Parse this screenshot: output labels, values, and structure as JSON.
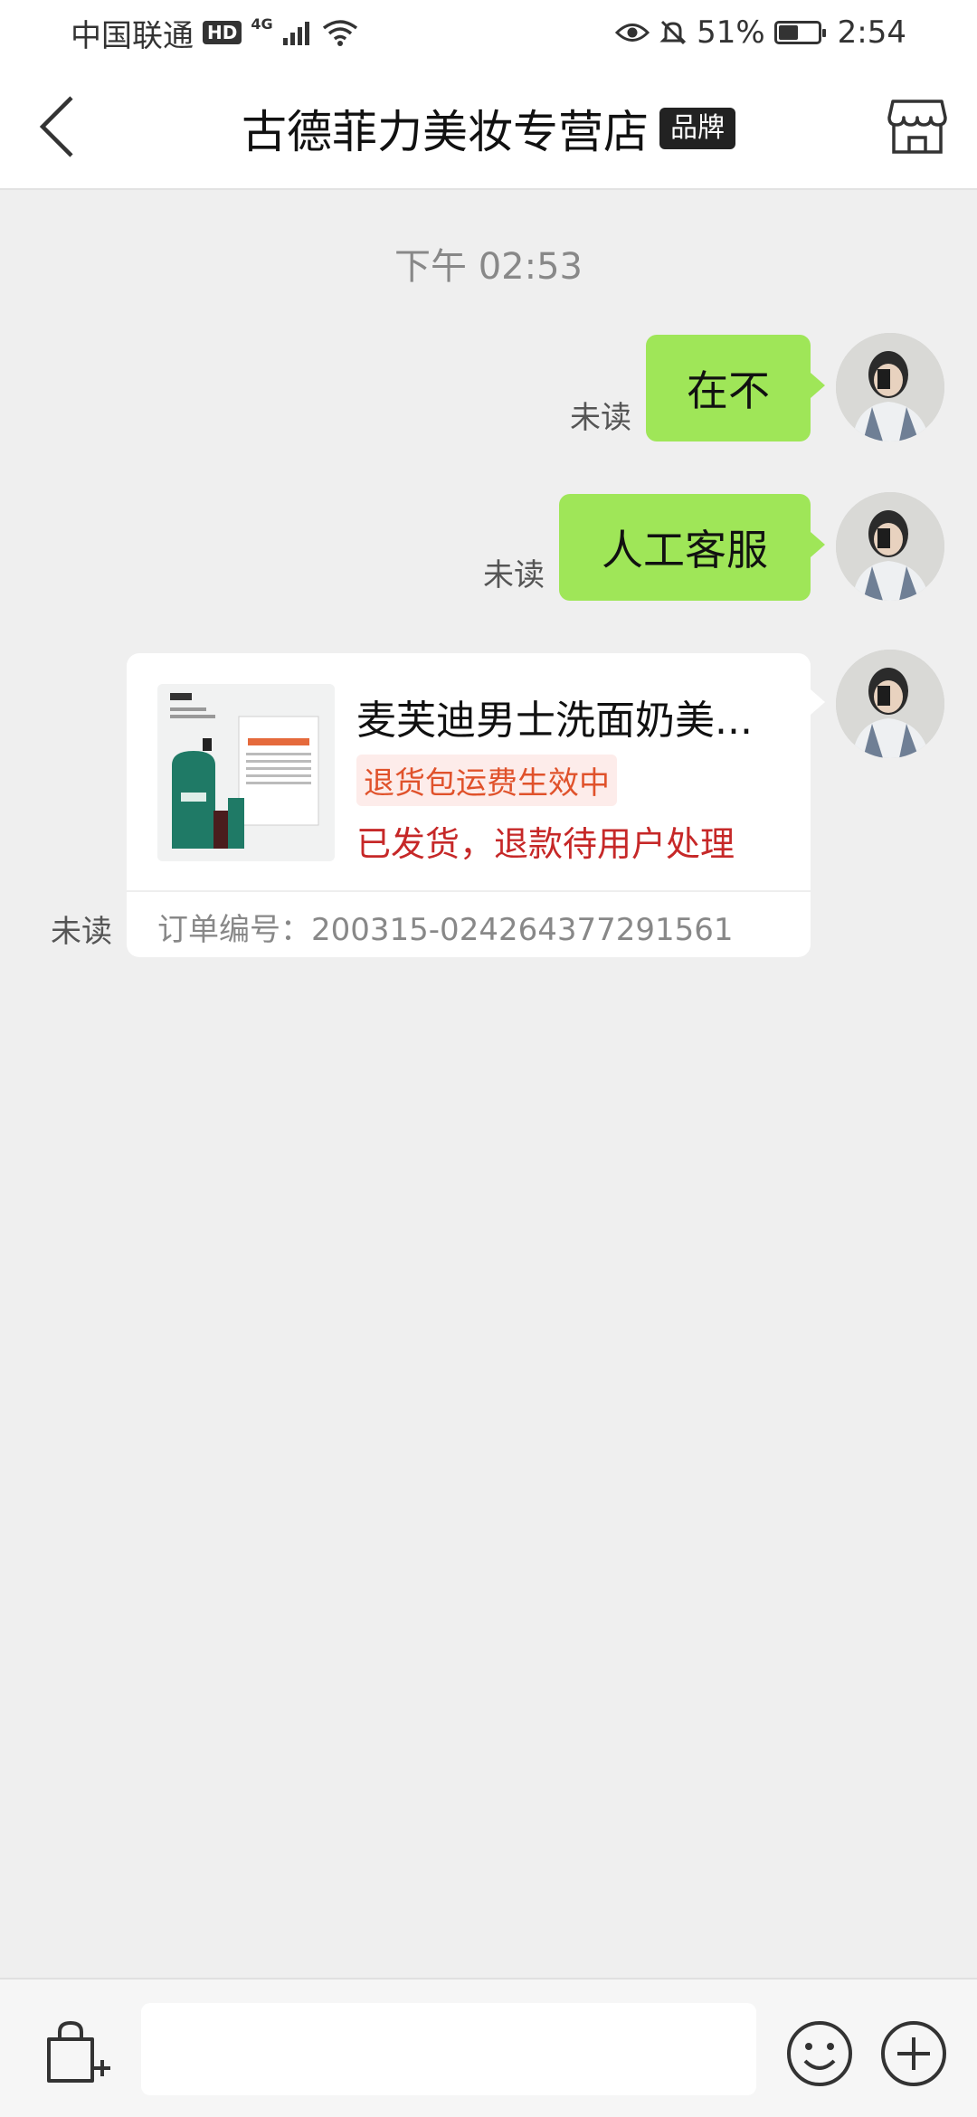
{
  "status_bar": {
    "carrier": "中国联通",
    "hd": "HD",
    "network": "4G",
    "battery_percent": "51%",
    "battery_level": 0.51,
    "time": "2:54",
    "icons": [
      "signal-icon",
      "wifi-icon",
      "eye-icon",
      "bell-muted-icon",
      "battery-icon"
    ]
  },
  "header": {
    "title": "古德菲力美妆专营店",
    "badge": "品牌",
    "back_icon": "chevron-left-icon",
    "store_icon": "store-icon"
  },
  "chat": {
    "timestamp": "下午 02:53",
    "messages": [
      {
        "type": "text",
        "text": "在不",
        "status": "未读"
      },
      {
        "type": "text",
        "text": "人工客服",
        "status": "未读"
      },
      {
        "type": "order",
        "product_title": "麦芙迪男士洗面奶美...",
        "tag": "退货包运费生效中",
        "order_status": "已发货，退款待用户处理",
        "order_number": "订单编号：200315-024264377291561",
        "status": "未读"
      }
    ]
  },
  "input_bar": {
    "icons": [
      "shopping-bag-add-icon",
      "emoji-icon",
      "plus-icon"
    ],
    "placeholder": ""
  },
  "colors": {
    "bubble": "#9fe658",
    "background": "#efefef",
    "status_red": "#c62828",
    "tag_orange": "#e0522b"
  }
}
